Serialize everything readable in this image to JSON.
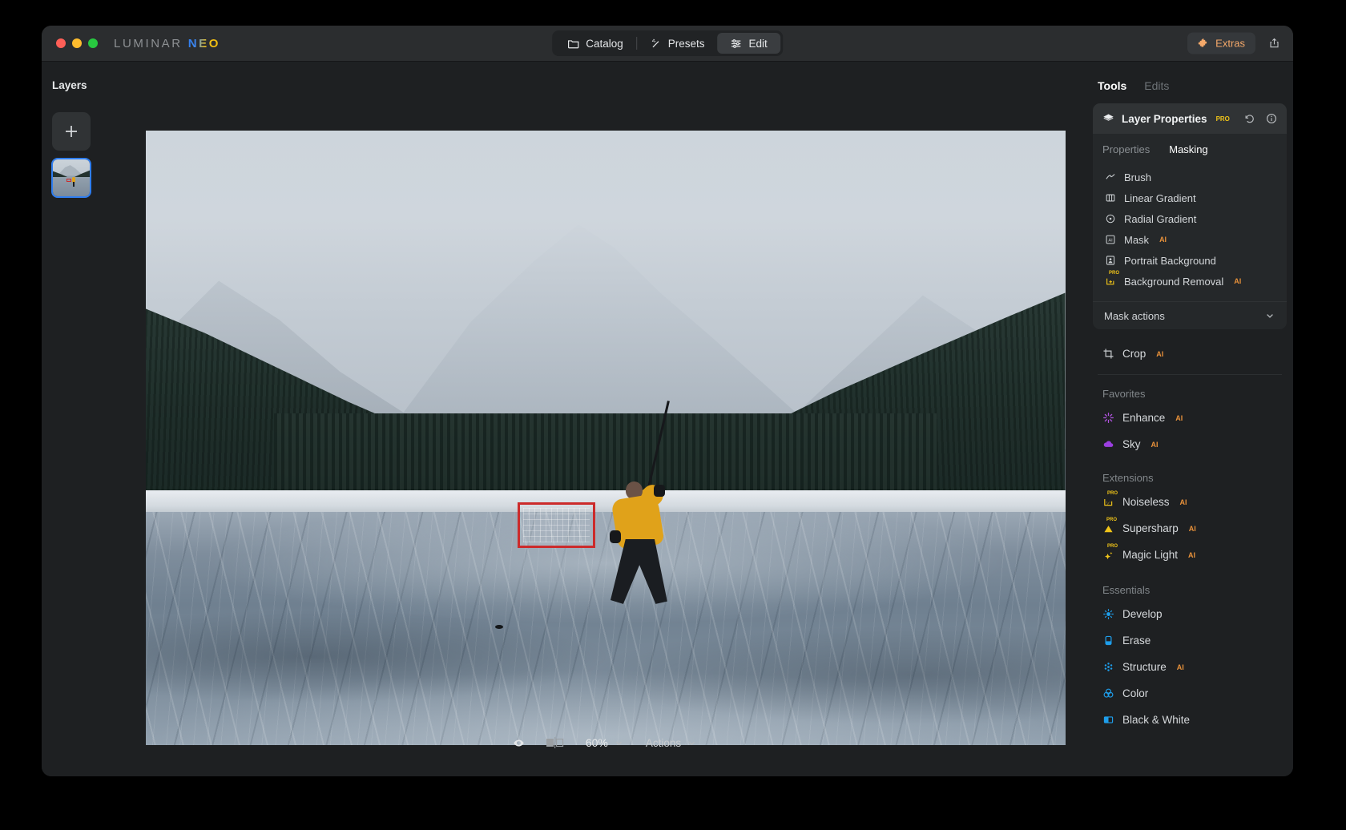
{
  "app": {
    "brand_primary": "LUMINAR",
    "brand_secondary": "NEO"
  },
  "titlebar": {
    "nav": [
      {
        "label": "Catalog",
        "icon": "folder-icon",
        "active": false
      },
      {
        "label": "Presets",
        "icon": "magic-wand-icon",
        "active": false
      },
      {
        "label": "Edit",
        "icon": "sliders-icon",
        "active": true
      }
    ],
    "extras_label": "Extras",
    "extras_icon": "puzzle-piece-icon",
    "extras_color": "#f5a96a",
    "share_icon": "share-icon"
  },
  "layers": {
    "title": "Layers",
    "add_label": "+",
    "thumbnails": [
      {
        "name": "hockey-photo-layer",
        "selected": true
      }
    ],
    "selection_color": "#2f7ef0"
  },
  "bottom_bar": {
    "eye_icon": "eye-icon",
    "compare_icon": "before-after-icon",
    "zoom_value": "60%",
    "zoom_chevron": "chevron-down-icon",
    "actions_label": "Actions",
    "actions_chevron": "chevron-down-icon"
  },
  "tools_panel": {
    "tabs": [
      {
        "label": "Tools",
        "active": true
      },
      {
        "label": "Edits",
        "active": false
      }
    ],
    "layer_properties": {
      "title": "Layer Properties",
      "badge": "PRO",
      "badge_color": "#f0c419",
      "icon": "layers-icon",
      "reset_icon": "undo-icon",
      "info_icon": "info-icon",
      "subtabs": [
        {
          "label": "Properties",
          "active": false
        },
        {
          "label": "Masking",
          "active": true
        }
      ],
      "mask_tools": [
        {
          "label": "Brush",
          "icon": "brush-icon",
          "badge": "",
          "icon_color": "#c9cdd0"
        },
        {
          "label": "Linear Gradient",
          "icon": "linear-gradient-icon",
          "badge": "",
          "icon_color": "#c9cdd0"
        },
        {
          "label": "Radial Gradient",
          "icon": "radial-gradient-icon",
          "badge": "",
          "icon_color": "#c9cdd0"
        },
        {
          "label": "Mask",
          "icon": "ai-mask-icon",
          "badge": "AI",
          "icon_color": "#c9cdd0"
        },
        {
          "label": "Portrait Background",
          "icon": "portrait-icon",
          "badge": "",
          "icon_color": "#c9cdd0"
        },
        {
          "label": "Background Removal",
          "icon": "background-removal-icon",
          "badge": "AI",
          "pro": "PRO",
          "icon_color": "#f0c419"
        }
      ],
      "mask_actions_label": "Mask actions",
      "mask_actions_chevron": "chevron-down-icon"
    },
    "crop": {
      "label": "Crop",
      "icon": "crop-icon",
      "badge": "AI",
      "icon_color": "#c9cdd0"
    },
    "sections": [
      {
        "label": "Favorites",
        "items": [
          {
            "label": "Enhance",
            "icon": "enhance-icon",
            "badge": "AI",
            "icon_color": "#b153e0"
          },
          {
            "label": "Sky",
            "icon": "cloud-icon",
            "badge": "AI",
            "icon_color": "#9b3fe0"
          }
        ]
      },
      {
        "label": "Extensions",
        "items": [
          {
            "label": "Noiseless",
            "icon": "noiseless-icon",
            "badge": "AI",
            "pro": "PRO",
            "icon_color": "#f0c419"
          },
          {
            "label": "Supersharp",
            "icon": "supersharp-icon",
            "badge": "AI",
            "pro": "PRO",
            "icon_color": "#f0c419"
          },
          {
            "label": "Magic Light",
            "icon": "magic-light-icon",
            "badge": "AI",
            "pro": "PRO",
            "icon_color": "#f0c419"
          }
        ]
      },
      {
        "label": "Essentials",
        "items": [
          {
            "label": "Develop",
            "icon": "develop-icon",
            "badge": "",
            "icon_color": "#1e9eeb"
          },
          {
            "label": "Erase",
            "icon": "erase-icon",
            "badge": "",
            "icon_color": "#1e9eeb"
          },
          {
            "label": "Structure",
            "icon": "structure-icon",
            "badge": "AI",
            "icon_color": "#1e9eeb"
          },
          {
            "label": "Color",
            "icon": "color-icon",
            "badge": "",
            "icon_color": "#1e9eeb"
          },
          {
            "label": "Black & White",
            "icon": "black-white-icon",
            "badge": "",
            "icon_color": "#1e9eeb"
          }
        ]
      }
    ]
  }
}
